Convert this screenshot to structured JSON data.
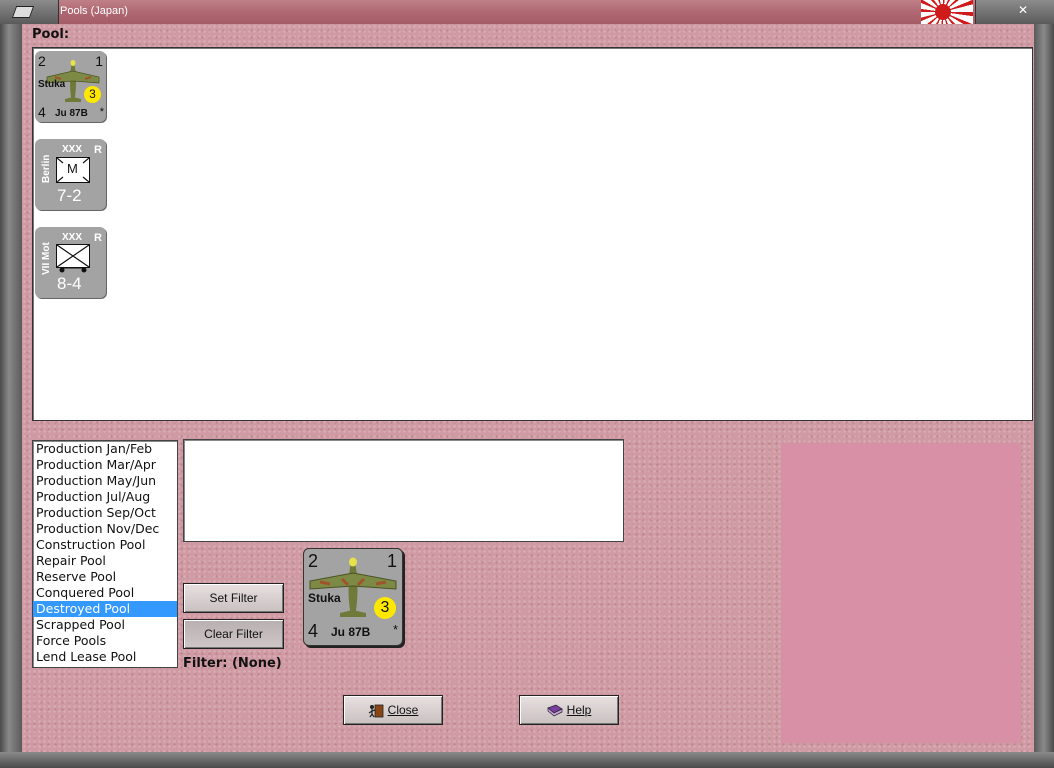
{
  "window": {
    "title": "Pools (Japan)",
    "close_glyph": "✕"
  },
  "pool": {
    "label": "Pool:",
    "counters": [
      {
        "kind": "air",
        "top_left": "2",
        "top_right": "1",
        "name": "Stuka",
        "badge": "3",
        "bottom_left": "4",
        "model": "Ju 87B",
        "mark": "*"
      },
      {
        "kind": "land",
        "size": "XXX",
        "flag": "R",
        "side_name": "Berlin",
        "symbol": "M",
        "strength": "7-2"
      },
      {
        "kind": "land",
        "size": "XXX",
        "flag": "R",
        "side_name": "VII Mot",
        "strength": "8-4"
      }
    ]
  },
  "pool_list": {
    "items": [
      "Production Jan/Feb",
      "Production Mar/Apr",
      "Production May/Jun",
      "Production Jul/Aug",
      "Production Sep/Oct",
      "Production Nov/Dec",
      "Construction Pool",
      "Repair Pool",
      "Reserve Pool",
      "Conquered Pool",
      "Destroyed Pool",
      "Scrapped Pool",
      "Force Pools",
      "Lend Lease Pool"
    ],
    "selected": "Destroyed Pool"
  },
  "selected_counter": {
    "top_left": "2",
    "top_right": "1",
    "name": "Stuka",
    "badge": "3",
    "bottom_left": "4",
    "model": "Ju 87B",
    "mark": "*"
  },
  "buttons": {
    "set_filter": "Set Filter",
    "clear_filter": "Clear Filter",
    "close": "Close",
    "help": "Help"
  },
  "filter": {
    "text": "Filter: (None)"
  },
  "colors": {
    "background": "#cf9aa3",
    "selection": "#3399ff",
    "counter": "#a3a3a3",
    "badge": "#ffe800",
    "panel": "#d890a6"
  }
}
